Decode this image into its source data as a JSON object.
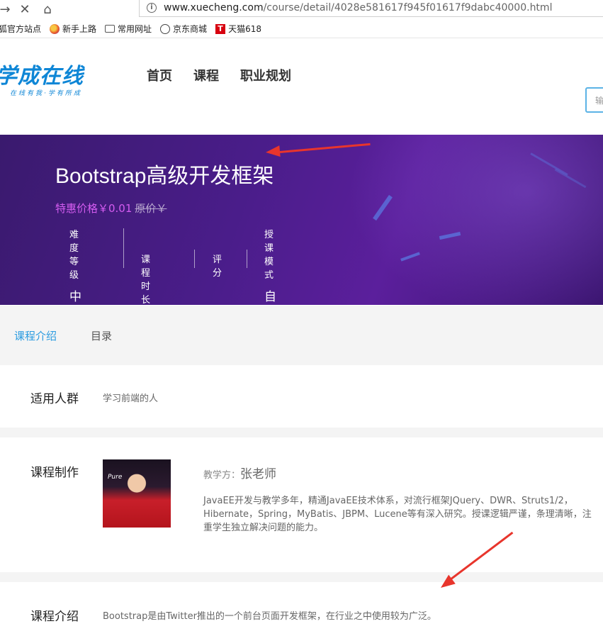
{
  "browser": {
    "url_domain": "www.xuecheng.com",
    "url_path": "/course/detail/4028e581617f945f01617f9dabc40000.html",
    "bookmarks": [
      {
        "label": "狐官方站点",
        "icon": "firefox-icon"
      },
      {
        "label": "新手上路",
        "icon": "firefox-icon"
      },
      {
        "label": "常用网址",
        "icon": "folder-icon"
      },
      {
        "label": "京东商城",
        "icon": "globe-icon"
      },
      {
        "label": "天猫618",
        "icon": "tmall-icon"
      }
    ]
  },
  "header": {
    "logo_main": "学成在线",
    "logo_sub": "在线有我·学有所成",
    "nav": [
      "首页",
      "课程",
      "职业规划"
    ],
    "search_placeholder": "输"
  },
  "course": {
    "title": "Bootstrap高级开发框架",
    "price_label": "特惠价格￥0.01",
    "original_price": "原价￥",
    "meta": {
      "difficulty_label": "难度等级",
      "difficulty_value": "中级",
      "duration_label": "课程时长",
      "rating_label": "评分",
      "mode_label": "授课模式",
      "mode_value": "自由学习"
    }
  },
  "tabs": [
    "课程介绍",
    "目录"
  ],
  "sections": {
    "audience_title": "适用人群",
    "audience_text": "学习前端的人",
    "maker_title": "课程制作",
    "teacher_prefix": "教学方：",
    "teacher_name": "张老师",
    "photo_label": "Pure",
    "teacher_bio": "JavaEE开发与教学多年，精通JavaEE技术体系，对流行框架JQuery、DWR、Struts1/2，Hibernate，Spring，MyBatis、JBPM、Lucene等有深入研究。授课逻辑严谨，条理清晰，注重学生独立解决问题的能力。",
    "intro_title": "课程介绍",
    "intro_text": "Bootstrap是由Twitter推出的一个前台页面开发框架，在行业之中使用较为广泛。"
  },
  "colors": {
    "brand_blue": "#0e86d6",
    "tab_active": "#2a9be0",
    "price_purple": "#d45cf0",
    "annotation_red": "#e8352c"
  }
}
